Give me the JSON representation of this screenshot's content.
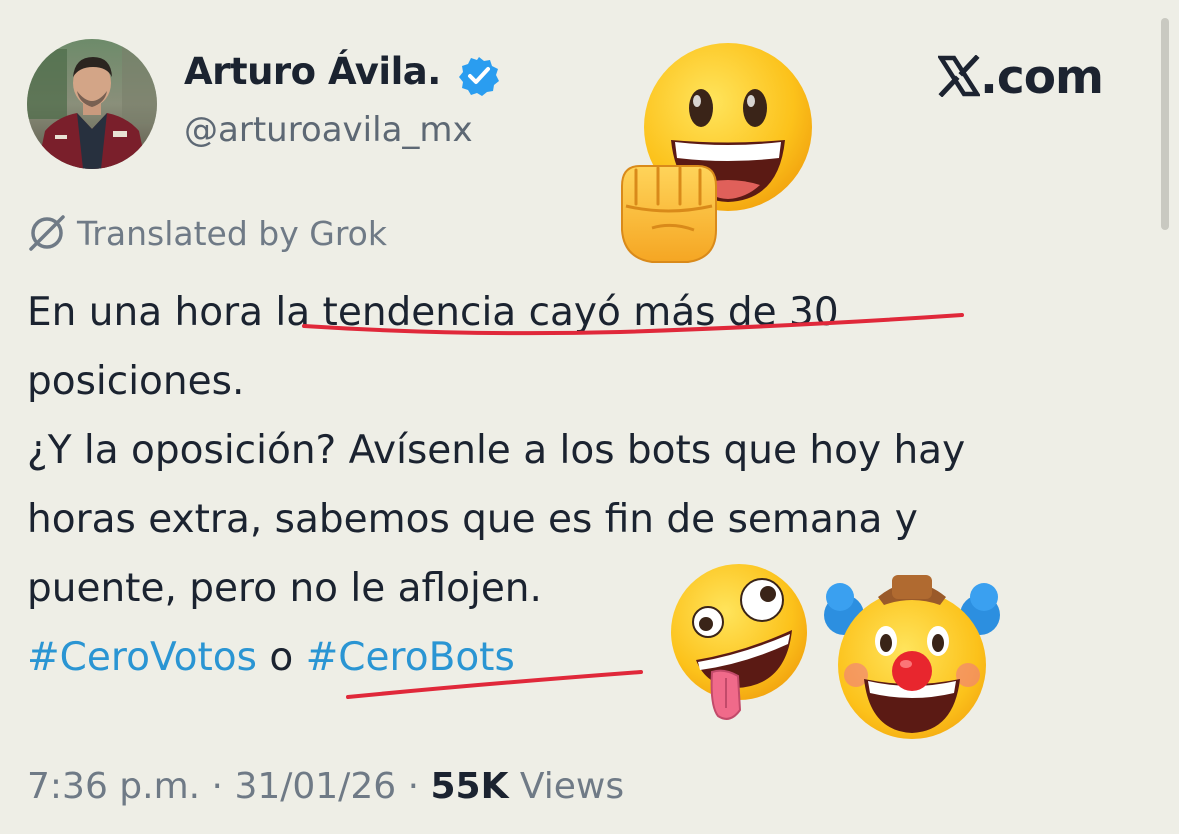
{
  "author": {
    "name": "Arturo Ávila.",
    "handle": "@arturoavila_mx",
    "verified": true,
    "avatar_icon": "profile-photo"
  },
  "site": {
    "logo_text": ".com",
    "logo_icon": "x-logo-icon"
  },
  "translation": {
    "label": "Translated by Grok",
    "icon": "grok-icon"
  },
  "tweet": {
    "lines": [
      {
        "parts": [
          {
            "text": "En una hora "
          },
          {
            "text": "la tendencia cayó más de 30"
          }
        ]
      },
      {
        "parts": [
          {
            "text": "posiciones."
          }
        ]
      },
      {
        "parts": [
          {
            "text": "¿Y la oposición?  Avísenle a los bots que hoy hay"
          }
        ]
      },
      {
        "parts": [
          {
            "text": "horas extra, sabemos que es fin de semana y"
          }
        ]
      },
      {
        "parts": [
          {
            "text": "puente, pero no le aflojen."
          }
        ]
      }
    ],
    "hashtags": {
      "first": "#CeroVotos",
      "connector": "o",
      "second": "#CeroBots"
    }
  },
  "emojis": [
    "grinning-face-emoji",
    "oncoming-fist-emoji",
    "zany-face-emoji",
    "clown-face-emoji"
  ],
  "meta": {
    "time": "7:36 p.m.",
    "separator": " · ",
    "date": "31/01/26",
    "views_count": "55K",
    "views_label": "Views"
  },
  "colors": {
    "background": "#eeeee6",
    "text": "#1b2330",
    "secondary_text": "#6f7a86",
    "hashtag": "#2a95d3",
    "verified_badge": "#2a9df0",
    "scribble_underline": "#e0283a"
  }
}
